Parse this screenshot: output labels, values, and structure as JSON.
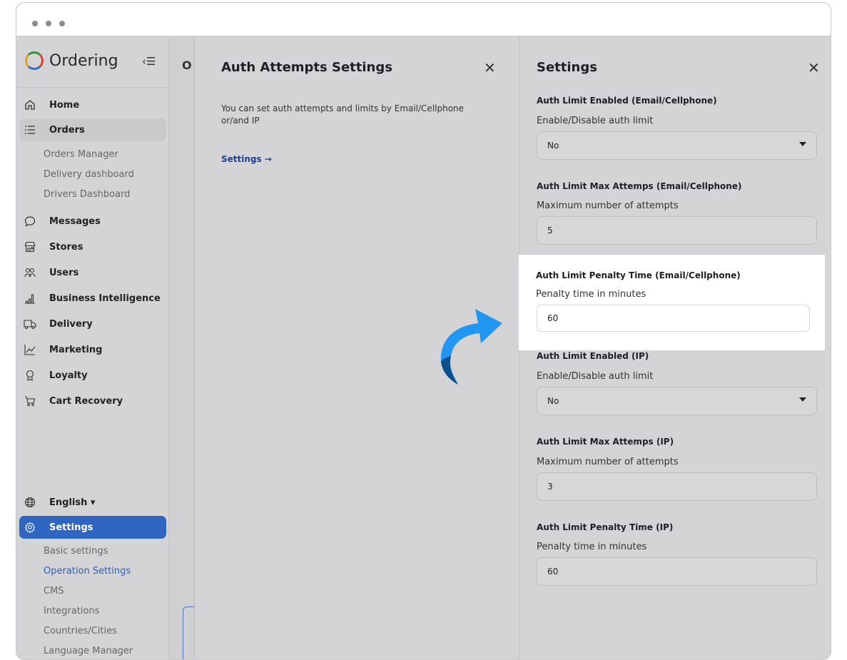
{
  "brand": {
    "name": "Ordering"
  },
  "sidebar": {
    "nav": [
      {
        "label": "Home",
        "icon": "home-icon"
      },
      {
        "label": "Orders",
        "icon": "list-icon"
      },
      {
        "label": "Messages",
        "icon": "chat-bubble-icon"
      },
      {
        "label": "Stores",
        "icon": "store-icon"
      },
      {
        "label": "Users",
        "icon": "users-icon"
      },
      {
        "label": "Business Intelligence",
        "icon": "bar-chart-icon"
      },
      {
        "label": "Delivery",
        "icon": "truck-icon"
      },
      {
        "label": "Marketing",
        "icon": "line-chart-icon"
      },
      {
        "label": "Loyalty",
        "icon": "award-icon"
      },
      {
        "label": "Cart Recovery",
        "icon": "cart-icon"
      }
    ],
    "orders_sub": [
      "Orders Manager",
      "Delivery dashboard",
      "Drivers Dashboard"
    ],
    "language": "English ▾",
    "settings": {
      "label": "Settings",
      "icon": "gear-icon"
    },
    "settings_sub": [
      "Basic settings",
      "Operation Settings",
      "CMS",
      "Integrations",
      "Countries/Cities",
      "Language Manager"
    ],
    "selected_sub": "Operation Settings"
  },
  "background_page": {
    "title_fragment": "O"
  },
  "auth_panel": {
    "title": "Auth Attempts Settings",
    "description": "You can set auth attempts and limits by Email/Cellphone or/and IP",
    "link": "Settings →"
  },
  "settings_panel": {
    "title": "Settings",
    "fields": [
      {
        "label": "Auth Limit Enabled (Email/Cellphone)",
        "sub": "Enable/Disable auth limit",
        "value": "No",
        "type": "select"
      },
      {
        "label": "Auth Limit Max Attemps (Email/Cellphone)",
        "sub": "Maximum number of attempts",
        "value": "5",
        "type": "input"
      },
      {
        "label": "Auth Limit Penalty Time (Email/Cellphone)",
        "sub": "Penalty time in minutes",
        "value": "60",
        "type": "input",
        "highlighted": true
      },
      {
        "label": "Auth Limit Enabled (IP)",
        "sub": "Enable/Disable auth limit",
        "value": "No",
        "type": "select"
      },
      {
        "label": "Auth Limit Max Attemps (IP)",
        "sub": "Maximum number of attempts",
        "value": "3",
        "type": "input"
      },
      {
        "label": "Auth Limit Penalty Time (IP)",
        "sub": "Penalty time in minutes",
        "value": "60",
        "type": "input"
      }
    ]
  },
  "colors": {
    "accent": "#2f66c2",
    "link": "#1f3f8a",
    "pointer_arrow": "#2196f3"
  }
}
